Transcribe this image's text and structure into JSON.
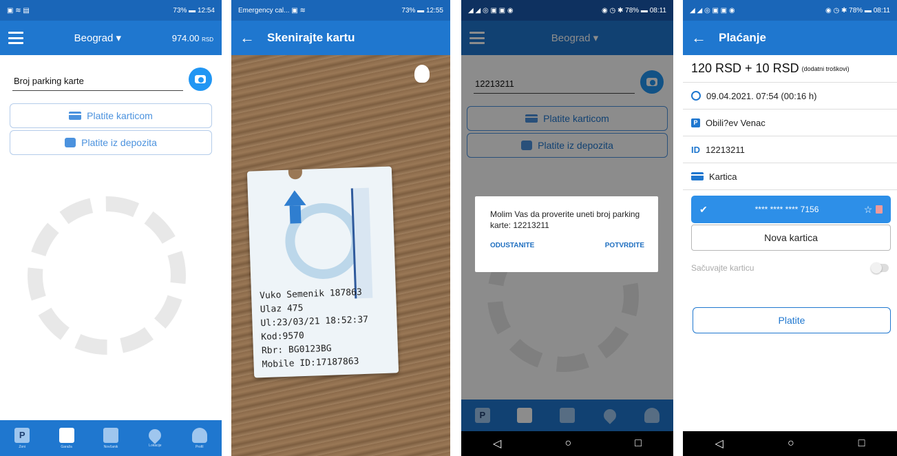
{
  "screen1": {
    "status": {
      "left": "▣ ≋ ▤",
      "right": "73% ▬ 12:54"
    },
    "city": "Beograd",
    "balance": "974.00",
    "currency": "RSD",
    "input_placeholder": "Broj parking karte",
    "pay_card": "Platite karticom",
    "pay_deposit": "Platite iz depozita",
    "nav": [
      "P",
      "",
      "",
      "",
      ""
    ],
    "nav_labels": [
      "Zoni",
      "Garaža",
      "Novčanik",
      "Lokacije",
      "Profil"
    ]
  },
  "screen2": {
    "status": {
      "left": "Emergency cal... ▣ ≋",
      "right": "73% ▬ 12:55"
    },
    "title": "Skenirajte kartu",
    "ticket_lines": [
      "Vuko Semenik 187863",
      "Ulaz 475",
      "Ul:23/03/21 18:52:37",
      "Kod:9570",
      "Rbr: BG0123BG",
      "Mobile ID:17187863"
    ]
  },
  "screen3": {
    "status": {
      "left": "◢ ◢ ◎ ▣ ▣ ◉",
      "right": "◉ ◷ ✱ 78% ▬ 08:11"
    },
    "city": "Beograd",
    "input_value": "12213211",
    "pay_card": "Platite karticom",
    "pay_deposit": "Platite iz depozita",
    "dialog_message": "Molim Vas da proverite uneti broj parking karte: 12213211",
    "dialog_cancel": "ODUSTANITE",
    "dialog_confirm": "POTVRDITE",
    "sysnav": [
      "◁",
      "○",
      "□"
    ]
  },
  "screen4": {
    "status": {
      "left": "◢ ◢ ◎ ▣ ▣ ◉",
      "right": "◉ ◷ ✱ 78% ▬ 08:11"
    },
    "title": "Plaćanje",
    "amount": "120 RSD + 10 RSD",
    "amount_note": "(dodatni troškovi)",
    "datetime": "09.04.2021. 07:54 (00:16 h)",
    "location": "Obili?ev Venac",
    "id_label": "ID",
    "id_value": "12213211",
    "method": "Kartica",
    "card_masked": "**** **** **** 7156",
    "new_card": "Nova kartica",
    "save_card": "Sačuvajte karticu",
    "pay": "Platite",
    "sysnav": [
      "◁",
      "○",
      "□"
    ]
  }
}
